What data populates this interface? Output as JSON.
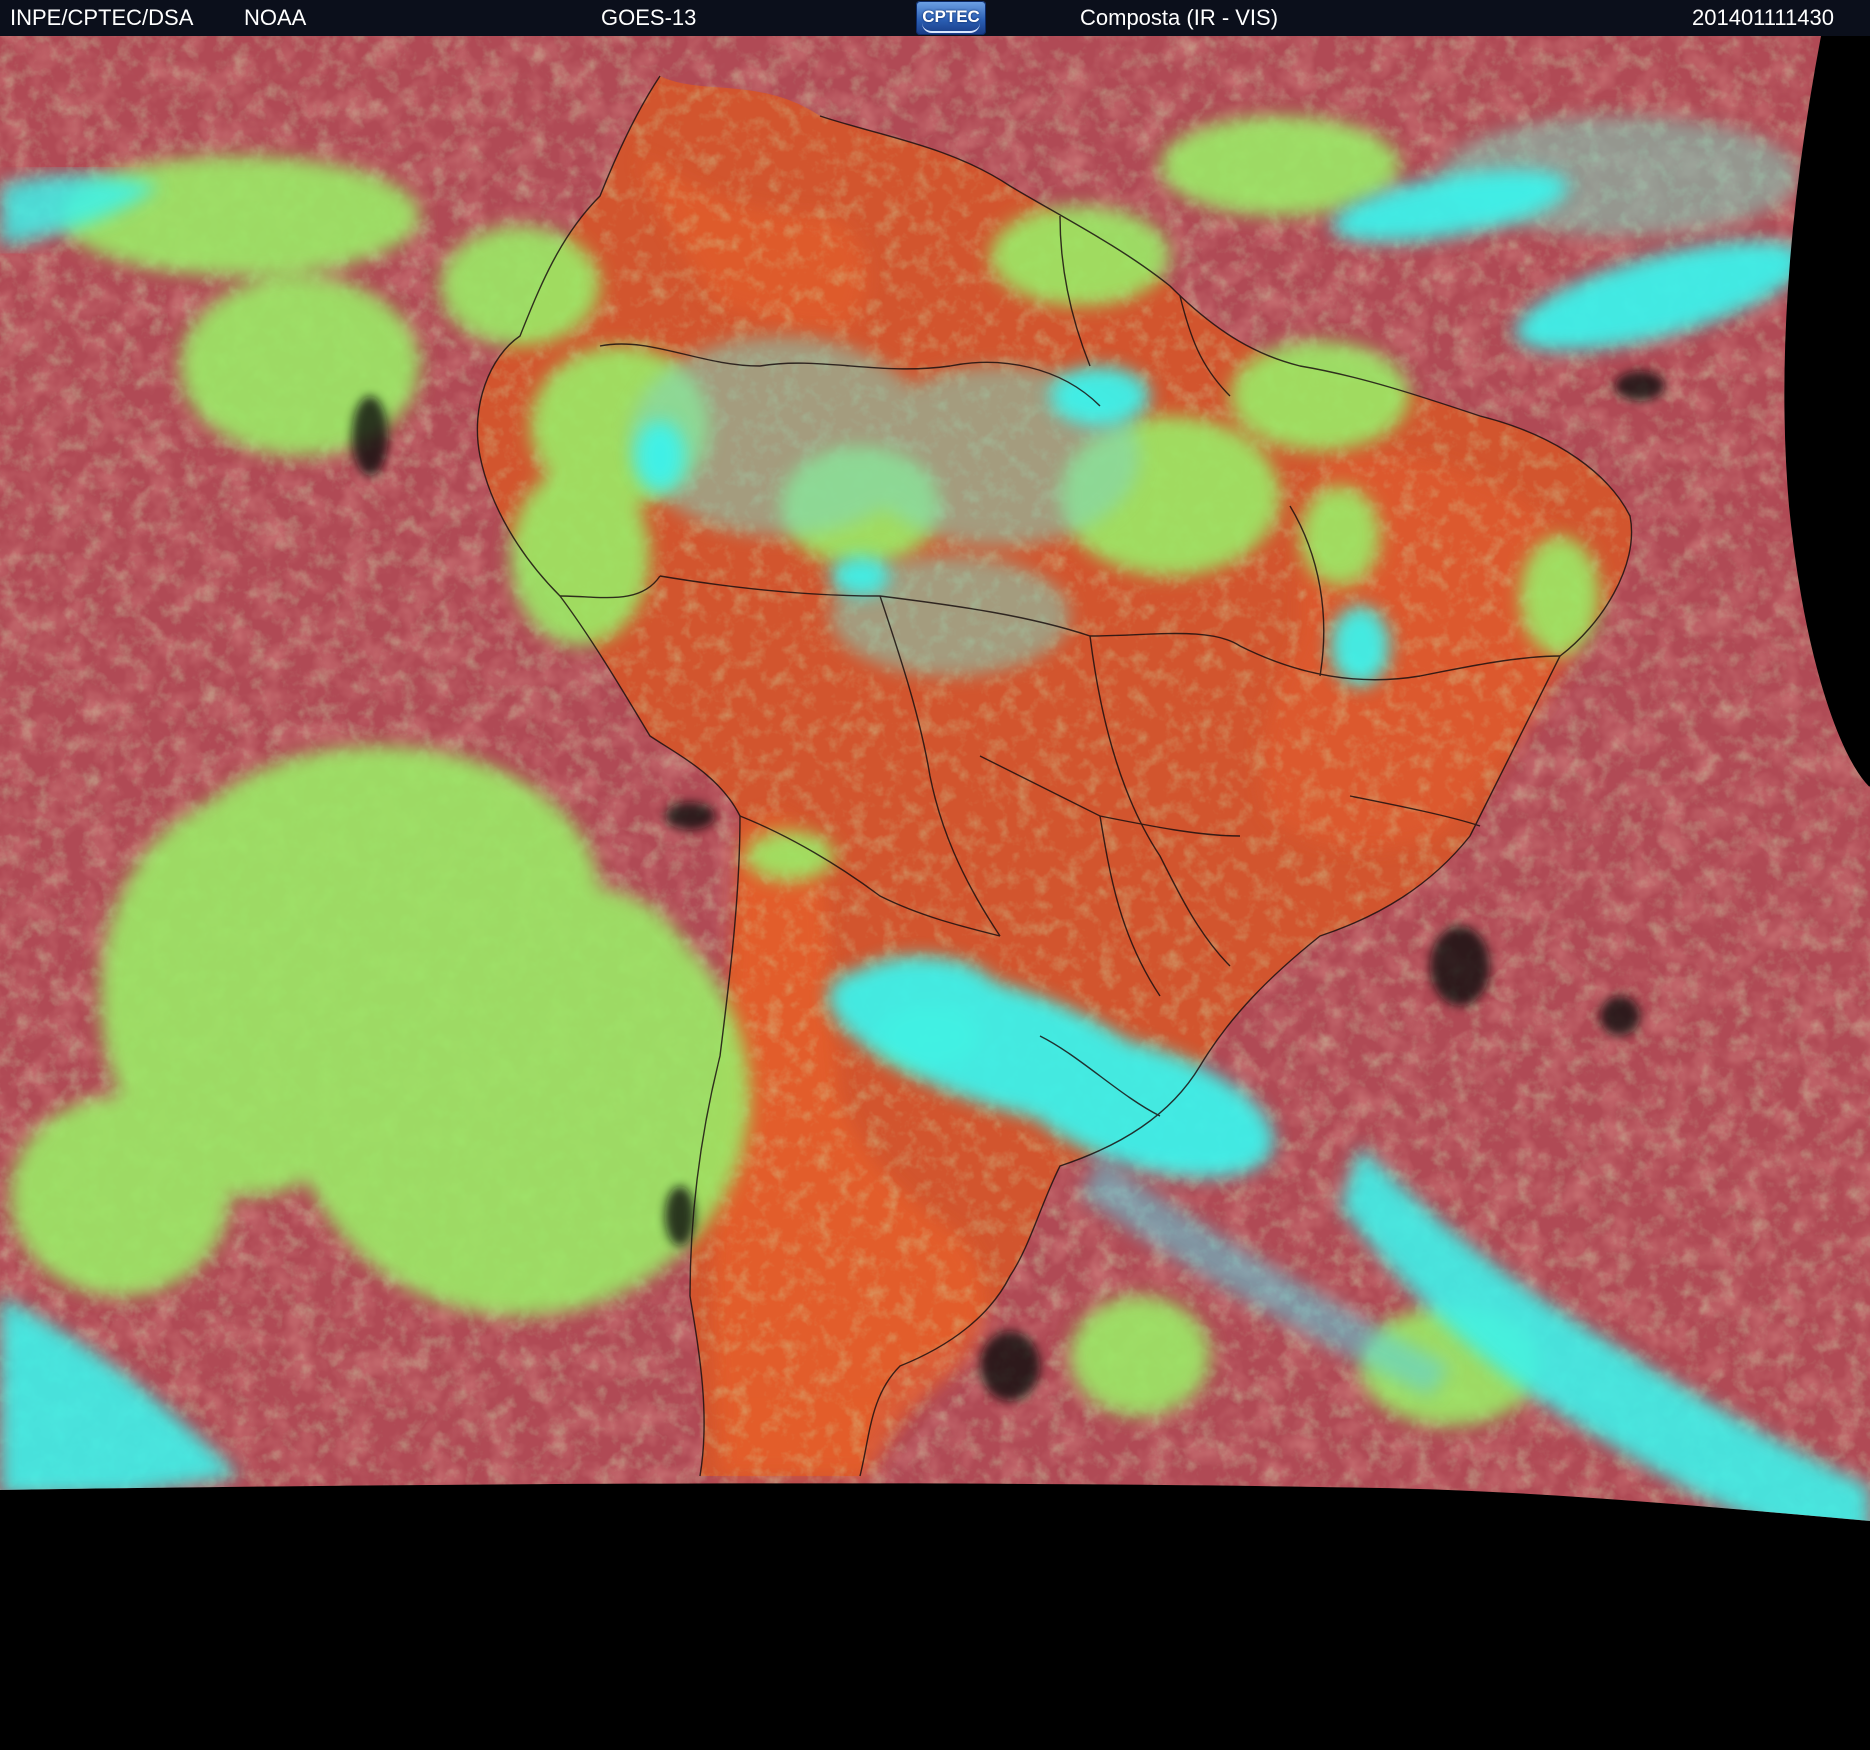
{
  "header": {
    "organization": "INPE/CPTEC/DSA",
    "agency": "NOAA",
    "satellite": "GOES-13",
    "logo_text": "CPTEC",
    "product": "Composta (IR - VIS)",
    "timestamp": "201401111430"
  },
  "palette": {
    "ocean_clear": "#b04a55",
    "land_clear": "#d9582f",
    "low_cloud": "#9bea66",
    "high_cloud": "#3ef2ea",
    "very_cold": "#111111",
    "background": "#000000",
    "header_bg": "#0b0f1b"
  },
  "image": {
    "description_icon": "satellite-composite-image"
  }
}
